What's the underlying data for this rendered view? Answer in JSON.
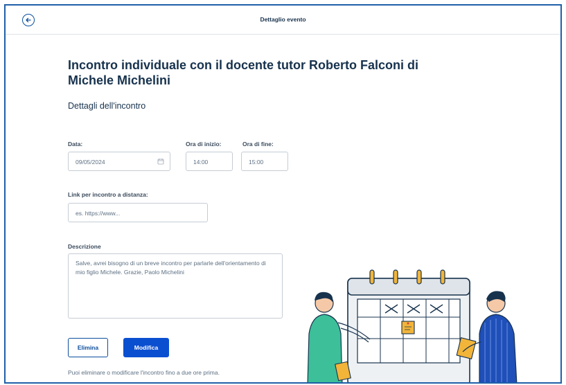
{
  "header": {
    "title": "Dettaglio evento",
    "back_icon": "arrow-left-circle-icon"
  },
  "event": {
    "title": "Incontro individuale con il docente tutor Roberto Falconi di Michele Michelini",
    "section_title": "Dettagli dell'incontro"
  },
  "form": {
    "date_label": "Data:",
    "date_value": "09/05/2024",
    "date_icon": "calendar-icon",
    "start_label": "Ora di inizio:",
    "start_value": "14:00",
    "end_label": "Ora di fine:",
    "end_value": "15:00",
    "link_label": "Link per incontro a distanza:",
    "link_placeholder": "es. https://www...",
    "description_label": "Descrizione",
    "description_value": "Salve, avrei bisogno di un breve incontro per parlarle dell'orientamento di mio figlio Michele. Grazie, Paolo Michelini"
  },
  "actions": {
    "delete_label": "Elimina",
    "edit_label": "Modifica"
  },
  "note": "Puoi eliminare o modificare l'incontro fino a due ore prima.",
  "colors": {
    "primary": "#0b4fd1",
    "accent_frame": "#1f5fa8",
    "text": "#17324d"
  }
}
